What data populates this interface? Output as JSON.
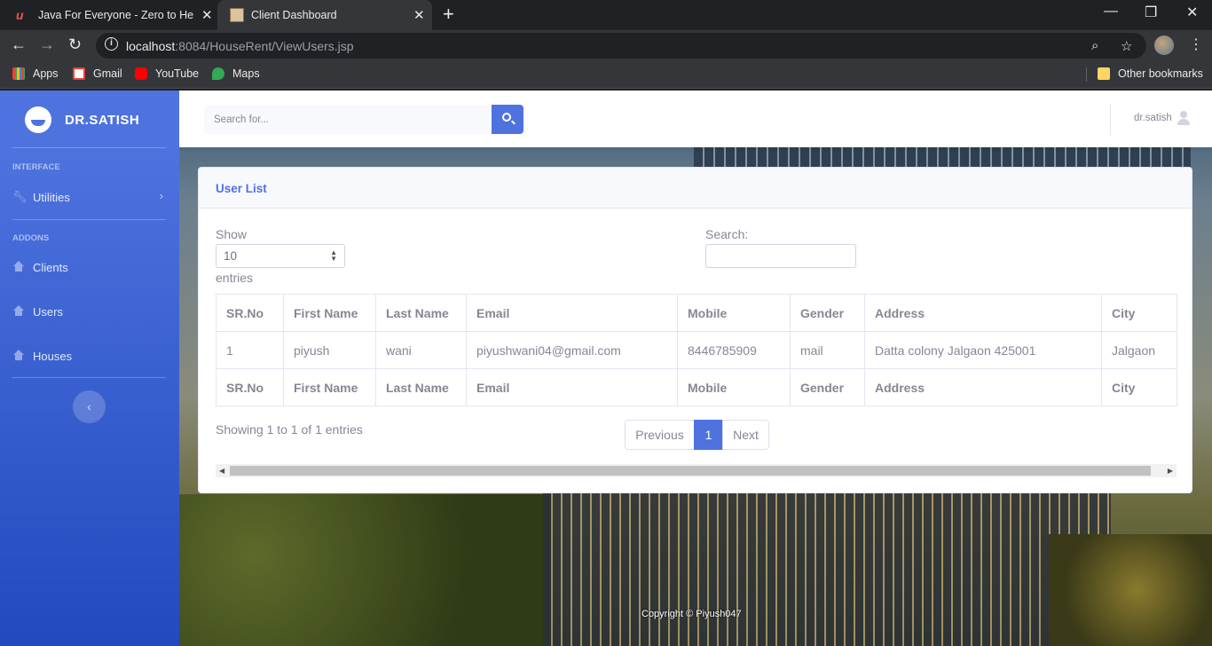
{
  "browser": {
    "tabs": [
      {
        "title": "Java For Everyone - Zero to Hero",
        "active": false
      },
      {
        "title": "Client Dashboard",
        "active": true
      }
    ],
    "url_host": "localhost",
    "url_path": ":8084/HouseRent/ViewUsers.jsp",
    "bookmarks": [
      "Apps",
      "Gmail",
      "YouTube",
      "Maps"
    ],
    "other_bookmarks": "Other bookmarks"
  },
  "sidebar": {
    "brand": "DR.SATISH",
    "headings": [
      "INTERFACE",
      "ADDONS"
    ],
    "items": [
      {
        "label": "Utilities",
        "icon": "wrench-icon"
      },
      {
        "label": "Clients",
        "icon": "home-icon"
      },
      {
        "label": "Users",
        "icon": "home-icon"
      },
      {
        "label": "Houses",
        "icon": "home-icon"
      }
    ]
  },
  "topbar": {
    "search_placeholder": "Search for...",
    "username": "dr.satish"
  },
  "card": {
    "title": "User List",
    "show_label": "Show",
    "entries_value": "10",
    "entries_label": "entries",
    "search_label": "Search:",
    "columns": [
      "SR.No",
      "First Name",
      "Last Name",
      "Email",
      "Mobile",
      "Gender",
      "Address",
      "City"
    ],
    "rows": [
      [
        "1",
        "piyush",
        "wani",
        "piyushwani04@gmail.com",
        "8446785909",
        "mail",
        "Datta colony Jalgaon 425001",
        "Jalgaon"
      ]
    ],
    "info": "Showing 1 to 1 of 1 entries",
    "pagination": {
      "previous": "Previous",
      "current": "1",
      "next": "Next"
    }
  },
  "footer": {
    "copyright": "Copyright © Piyush047"
  },
  "colors": {
    "primary": "#4e73df",
    "sidebar_dark": "#224abe",
    "text_muted": "#858796"
  }
}
